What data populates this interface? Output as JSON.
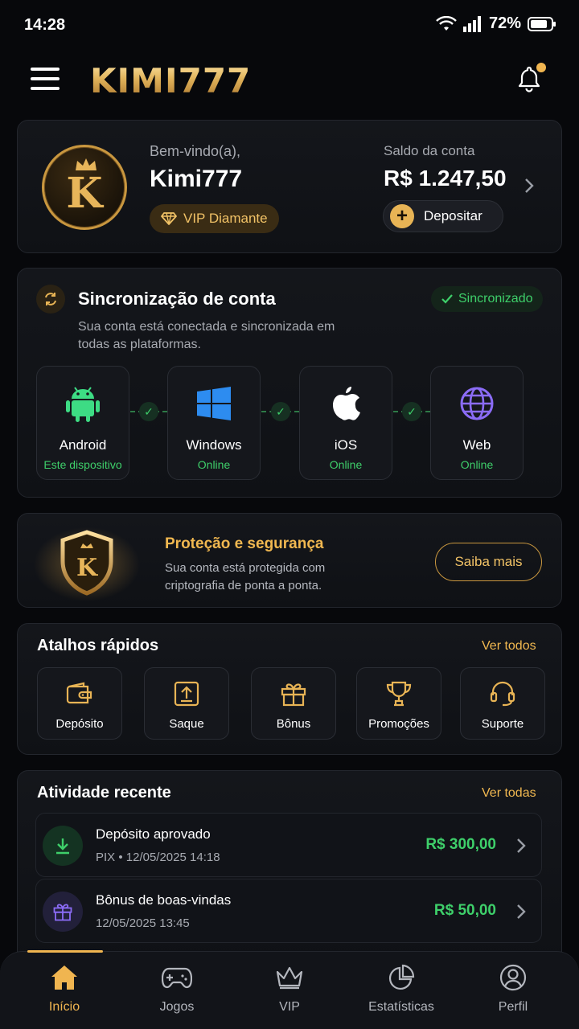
{
  "status_bar": {
    "time": "14:28",
    "battery": "72%"
  },
  "header": {
    "logo": "KIMI777",
    "menu_icon": "hamburger-icon",
    "bell_icon": "bell-icon"
  },
  "profile": {
    "avatar_letter": "K",
    "welcome": "Bem-vindo(a),",
    "username": "Kimi777",
    "vip_label": "VIP Diamante",
    "balance_label": "Saldo da conta",
    "balance": "R$ 1.247,50",
    "deposit_label": "Depositar"
  },
  "sync": {
    "title": "Sincronização de conta",
    "description": "Sua conta está conectada e sincronizada em todas as plataformas.",
    "badge": "Sincronizado",
    "platforms": [
      {
        "name": "Android",
        "status": "Este dispositivo",
        "icon": "android-icon"
      },
      {
        "name": "Windows",
        "status": "Online",
        "icon": "windows-icon"
      },
      {
        "name": "iOS",
        "status": "Online",
        "icon": "apple-icon"
      },
      {
        "name": "Web",
        "status": "Online",
        "icon": "globe-icon"
      }
    ]
  },
  "security": {
    "title": "Proteção e segurança",
    "description": "Sua conta está protegida com criptografia de ponta a ponta.",
    "button": "Saiba mais",
    "shield_letter": "K"
  },
  "shortcuts": {
    "title": "Atalhos rápidos",
    "see_all": "Ver todos",
    "items": [
      {
        "label": "Depósito",
        "icon": "wallet-icon"
      },
      {
        "label": "Saque",
        "icon": "upload-icon"
      },
      {
        "label": "Bônus",
        "icon": "gift-icon"
      },
      {
        "label": "Promoções",
        "icon": "trophy-icon"
      },
      {
        "label": "Suporte",
        "icon": "headset-icon"
      }
    ]
  },
  "activity": {
    "title": "Atividade recente",
    "see_all": "Ver todas",
    "items": [
      {
        "title": "Depósito aprovado",
        "subtitle": "PIX • 12/05/2025 14:18",
        "amount": "R$ 300,00",
        "icon": "download-icon"
      },
      {
        "title": "Bônus de boas-vindas",
        "subtitle": "12/05/2025 13:45",
        "amount": "R$ 50,00",
        "icon": "gift-icon"
      }
    ]
  },
  "bottom_nav": {
    "items": [
      {
        "label": "Início",
        "icon": "home-icon",
        "active": true
      },
      {
        "label": "Jogos",
        "icon": "gamepad-icon"
      },
      {
        "label": "VIP",
        "icon": "crown-icon"
      },
      {
        "label": "Estatísticas",
        "icon": "pie-chart-icon"
      },
      {
        "label": "Perfil",
        "icon": "user-icon"
      }
    ]
  },
  "colors": {
    "accent": "#f0b550",
    "success": "#3ecf6a",
    "background": "#07080b"
  }
}
